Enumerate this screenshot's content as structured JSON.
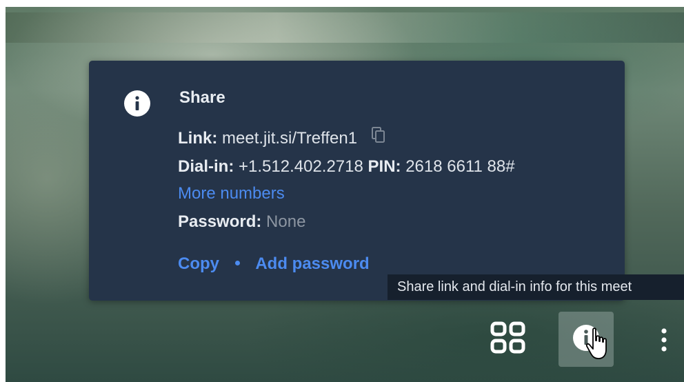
{
  "info_panel": {
    "icon": "info-icon",
    "title": "Share",
    "link_label": "Link:",
    "link_value": "meet.jit.si/Treffen1",
    "copy_icon": "copy-icon",
    "dialin_label": "Dial-in:",
    "dialin_value": "+1.512.402.2718",
    "pin_label": "PIN:",
    "pin_value": "2618 6611 88#",
    "more_numbers": "More numbers",
    "password_label": "Password:",
    "password_value": "None",
    "copy_action": "Copy",
    "add_password_action": "Add password"
  },
  "tooltip": {
    "text": "Share link and dial-in info for this meet"
  },
  "toolbar": {
    "tile_view_icon": "tile-view-icon",
    "info_icon": "info-icon",
    "more_icon": "more-vertical-icon",
    "cursor_icon": "hand-pointer-cursor"
  },
  "colors": {
    "panel_bg": "#253449",
    "accent": "#4c8bf0",
    "tooltip_bg": "#16202d",
    "muted_text": "#8d96a2"
  }
}
